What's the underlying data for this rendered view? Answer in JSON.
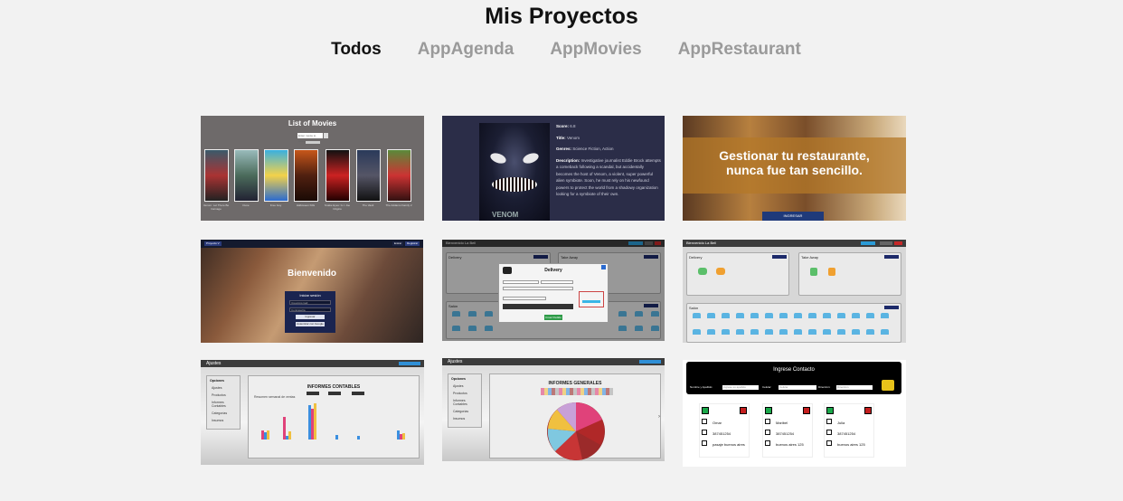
{
  "page": {
    "title": "Mis Proyectos"
  },
  "tabs": [
    {
      "label": "Todos",
      "active": true
    },
    {
      "label": "AppAgenda",
      "active": false
    },
    {
      "label": "AppMovies",
      "active": false
    },
    {
      "label": "AppRestaurant",
      "active": false
    }
  ],
  "cards": {
    "movies_list": {
      "title": "List of Movies",
      "search_placeholder": "Enter movie to search",
      "captions": [
        "Venom: Let There Be Carnage",
        "Dune",
        "Free Guy",
        "Halloween Kills",
        "Snake Eyes: G.I. Joe Origins",
        "The Vault",
        "The Addams Family 2"
      ]
    },
    "movie_detail": {
      "score_label": "Score:",
      "score_value": "6.8",
      "title_label": "Title:",
      "title_value": "Venom",
      "genres_label": "Genres:",
      "genres_value": "Science Fiction, Action",
      "desc_label": "Description:",
      "desc_value": "Investigative journalist Eddie Brock attempts a comeback following a scandal, but accidentally becomes the host of Venom, a violent, super powerful alien symbiote. Soon, he must rely on his newfound powers to protect the world from a shadowy organization looking for a symbiote of their own.",
      "poster_text": "VENOM"
    },
    "restaurant_home": {
      "headline_line1": "Gestionar tu restaurante,",
      "headline_line2": "nunca fue tan sencillo.",
      "button": "INGRESAR"
    },
    "login": {
      "nav_brand": "Proyecto V",
      "nav_btn1": "Entrar",
      "nav_btn2": "Registrar",
      "welcome": "Bienvenido",
      "form_title": "Iniciar sesión",
      "user_placeholder": "Usuario/email",
      "pass_placeholder": "Contraseña",
      "submit": "Ingresar",
      "google": "Autenticar con Google"
    },
    "delivery_modal": {
      "topbar": "Bienvenido La Bell",
      "panel1": "Delivery",
      "panel2": "Take Away",
      "panel3": "Salón",
      "modal_title": "Delivery",
      "modal_btn": "Crear Pedido"
    },
    "restaurant_admin": {
      "topbar": "Bienvenido La Bell",
      "panel1": "Delivery",
      "panel2": "Take Away",
      "panel3": "Salón"
    },
    "report_accounting": {
      "topbar": "Ajustes",
      "side_title": "Opciones",
      "side_items": [
        "Ajustes",
        "Productos",
        "Informes Contables",
        "Categorías",
        "Insumos"
      ],
      "chart_title": "INFORMES CONTABLES",
      "chart_sub": "Resumen semanal de ventas"
    },
    "report_general": {
      "topbar": "Ajustes",
      "side_title": "Opciones",
      "side_items": [
        "Ajustes",
        "Productos",
        "Informes Contables",
        "Categorías",
        "Insumos"
      ],
      "chart_title": "INFORMES GENERALES"
    },
    "contacts": {
      "header": "Ingrese Contacto",
      "field1": "Nombre y Apellido:",
      "field2": "Celular:",
      "field3": "Dirección:",
      "field1_ph": "ingrese su apellido",
      "field2_ph": "Celular",
      "field3_ph": "Dirección",
      "contacts": [
        {
          "name": "Omar",
          "phone": "387451254",
          "address": "pasaje buenos aires"
        },
        {
          "name": "Maribel",
          "phone": "387451254",
          "address": "buenos aires 125"
        },
        {
          "name": "Julia",
          "phone": "387451254",
          "address": "buenos aires 125"
        }
      ]
    }
  }
}
